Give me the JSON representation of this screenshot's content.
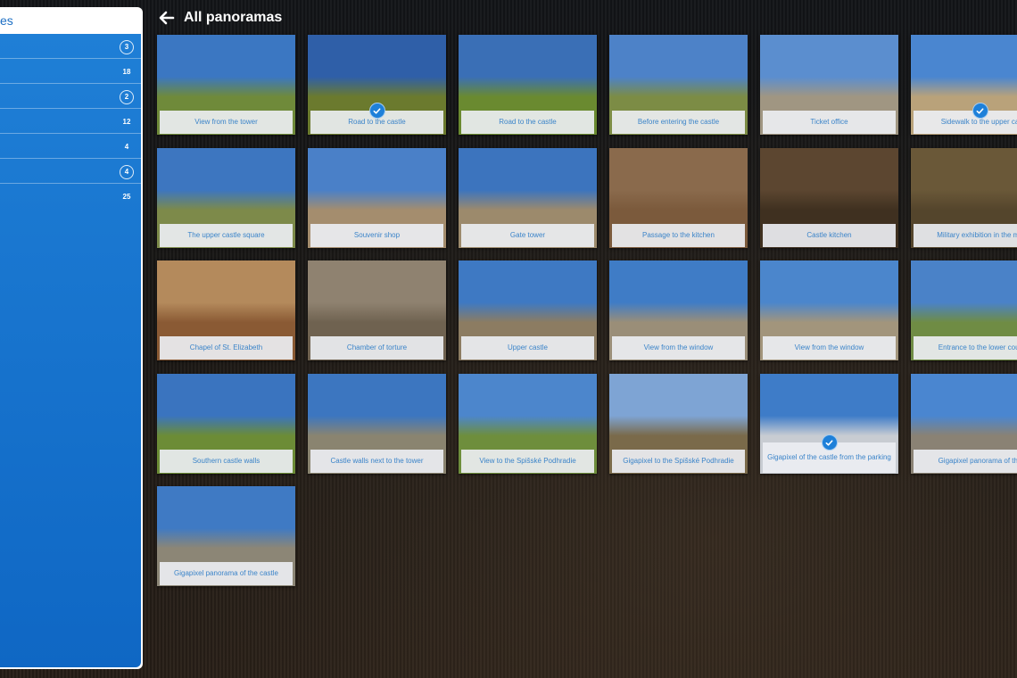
{
  "sidebar": {
    "header": "es",
    "rows": [
      {
        "count": "3",
        "ring": true
      },
      {
        "count": "18",
        "ring": false
      },
      {
        "count": "2",
        "ring": true
      },
      {
        "count": "12",
        "ring": false
      },
      {
        "count": "4",
        "ring": false
      },
      {
        "count": "4",
        "ring": true
      },
      {
        "count": "25",
        "ring": false
      }
    ]
  },
  "header": {
    "title": "All panoramas",
    "back_icon": "arrow-left-icon"
  },
  "accent_color": "#1e80d9",
  "panoramas": [
    {
      "label": "View from the tower",
      "checked": false,
      "sky": "#3b77c2",
      "ground": "#6f8a3a"
    },
    {
      "label": "Road to the castle",
      "checked": true,
      "sky": "#2f5fa8",
      "ground": "#6b7a2e"
    },
    {
      "label": "Road to the castle",
      "checked": false,
      "sky": "#3a6fb6",
      "ground": "#6a8a30"
    },
    {
      "label": "Before entering the castle",
      "checked": false,
      "sky": "#4d82c8",
      "ground": "#7c8c45"
    },
    {
      "label": "Ticket office",
      "checked": false,
      "sky": "#5b8ecf",
      "ground": "#a09682"
    },
    {
      "label": "Sidewalk to the upper ca",
      "checked": true,
      "sky": "#4a86d0",
      "ground": "#b9a27a",
      "selected": true
    },
    {
      "label": "The upper castle square",
      "checked": false,
      "sky": "#3d76c0",
      "ground": "#7d8a4a"
    },
    {
      "label": "Souvenir shop",
      "checked": false,
      "sky": "#4a80c8",
      "ground": "#a48d6e"
    },
    {
      "label": "Gate tower",
      "checked": false,
      "sky": "#3c74be",
      "ground": "#9c8a6c"
    },
    {
      "label": "Passage to the kitchen",
      "checked": false,
      "sky": "#8a6a4c",
      "ground": "#7b5a3c"
    },
    {
      "label": "Castle kitchen",
      "checked": false,
      "sky": "#5c4630",
      "ground": "#3f3020"
    },
    {
      "label": "Military exhibition in the mu",
      "checked": false,
      "sky": "#6a5838",
      "ground": "#54452c"
    },
    {
      "label": "Chapel of St. Elizabeth",
      "checked": false,
      "sky": "#b48a5c",
      "ground": "#8a5a34"
    },
    {
      "label": "Chamber of torture",
      "checked": false,
      "sky": "#8f8270",
      "ground": "#6f6250"
    },
    {
      "label": "Upper castle",
      "checked": false,
      "sky": "#3e79c3",
      "ground": "#8c7c62"
    },
    {
      "label": "View from the window",
      "checked": false,
      "sky": "#3f7cc6",
      "ground": "#9a8e78"
    },
    {
      "label": "View from the window",
      "checked": false,
      "sky": "#4b86cc",
      "ground": "#a2957c"
    },
    {
      "label": "Entrance to the lower cour",
      "checked": false,
      "sky": "#4a82c8",
      "ground": "#6f8c44"
    },
    {
      "label": "Southern castle walls",
      "checked": false,
      "sky": "#3a74bf",
      "ground": "#6c8c36"
    },
    {
      "label": "Castle walls next to the tower",
      "checked": false,
      "sky": "#3c76c0",
      "ground": "#8a8470"
    },
    {
      "label": "View to the Spišské Podhradie",
      "checked": false,
      "sky": "#4c86cc",
      "ground": "#6e8e3c"
    },
    {
      "label": "Gigapixel to the Spišské Podhradie",
      "checked": false,
      "sky": "#7ea4d4",
      "ground": "#7a6a4a"
    },
    {
      "label": "Gigapixel of the castle from the parking",
      "checked": true,
      "sky": "#3e7cc8",
      "ground": "#c8ccd2",
      "wrap": true
    },
    {
      "label": "Gigapixel panorama of the",
      "checked": false,
      "sky": "#4a86d0",
      "ground": "#8a8274"
    },
    {
      "label": "Gigapixel panorama of the castle",
      "checked": false,
      "sky": "#3f7ac4",
      "ground": "#8c8676"
    }
  ]
}
